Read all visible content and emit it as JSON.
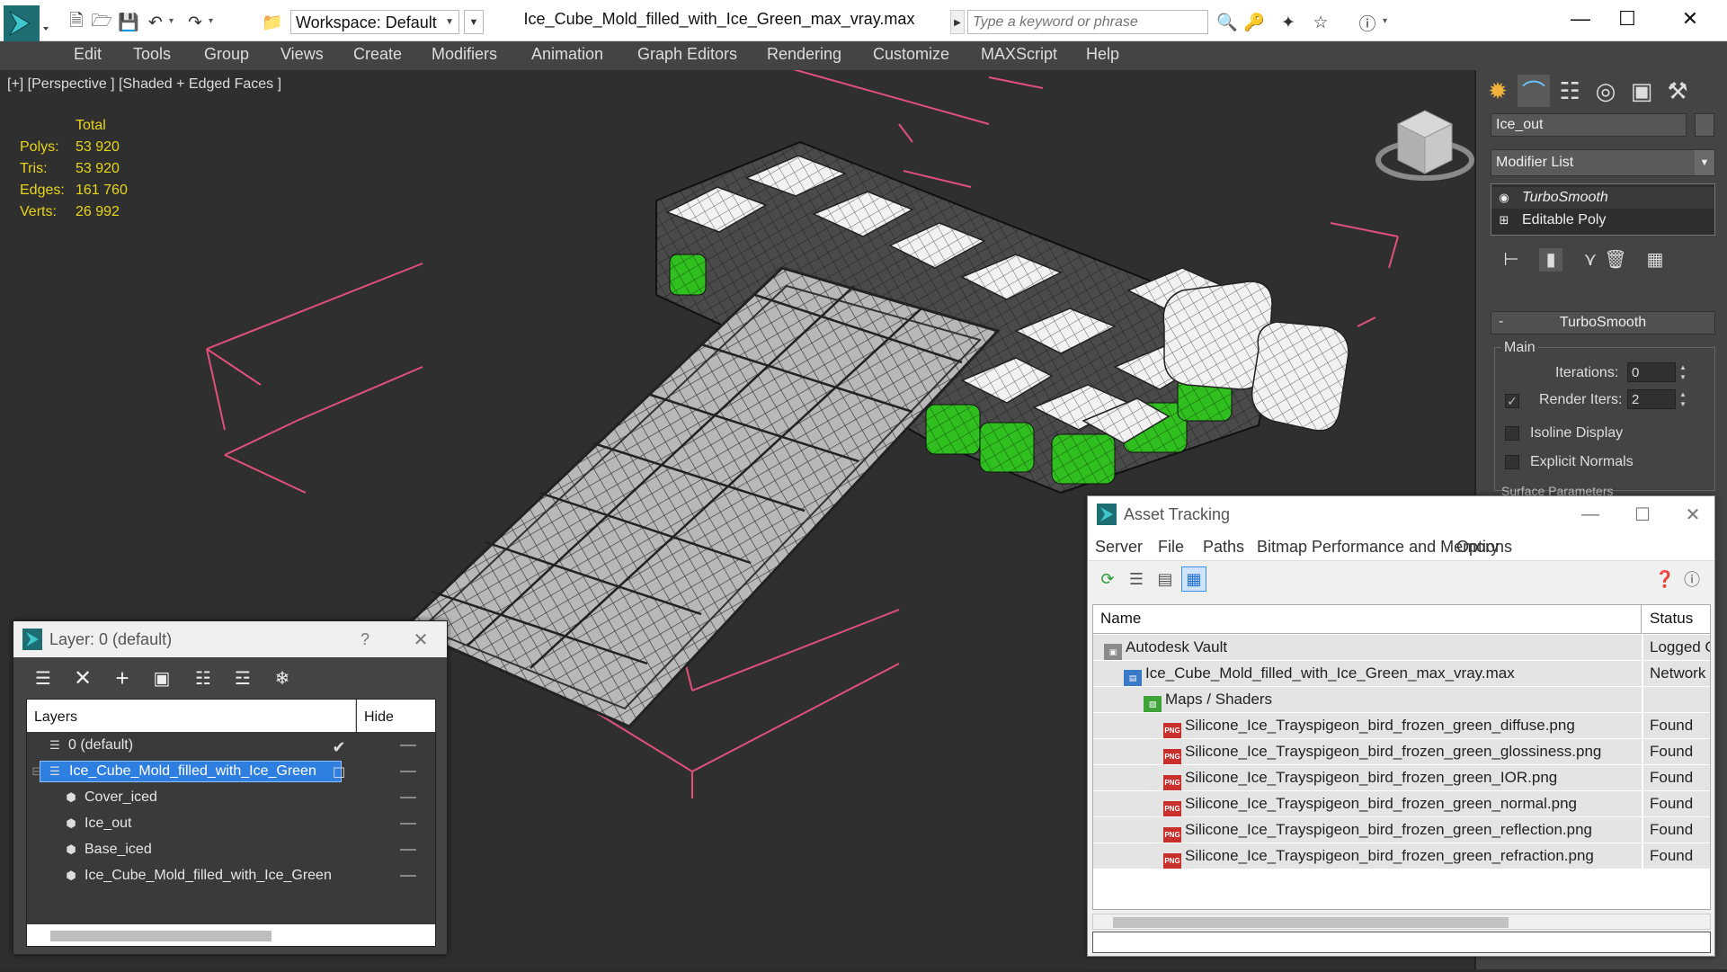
{
  "titlebar": {
    "workspace": "Workspace: Default",
    "document_title": "Ice_Cube_Mold_filled_with_Ice_Green_max_vray.max",
    "search_placeholder": "Type a keyword or phrase",
    "icons": [
      "new-file-icon",
      "open-folder-icon",
      "save-icon",
      "undo-icon",
      "redo-icon",
      "project-folder-icon",
      "binoculars-icon",
      "key-icon",
      "star-cross-icon",
      "favorite-star-icon",
      "help-icon"
    ]
  },
  "menu": [
    "Edit",
    "Tools",
    "Group",
    "Views",
    "Create",
    "Modifiers",
    "Animation",
    "Graph Editors",
    "Rendering",
    "Customize",
    "MAXScript",
    "Help"
  ],
  "viewport": {
    "label": "[+] [Perspective ] [Shaded + Edged Faces ]",
    "stats_header": "Total",
    "stats": [
      {
        "label": "Polys:",
        "value": "53 920"
      },
      {
        "label": "Tris:",
        "value": "53 920"
      },
      {
        "label": "Edges:",
        "value": "161 760"
      },
      {
        "label": "Verts:",
        "value": "26 992"
      }
    ]
  },
  "command_panel": {
    "object_name": "Ice_out",
    "modifier_list": "Modifier List",
    "stack": [
      "TurboSmooth",
      "Editable Poly"
    ],
    "rollout_title": "TurboSmooth",
    "group_main": "Main",
    "iterations_label": "Iterations:",
    "iterations_value": "0",
    "render_iters_label": "Render Iters:",
    "render_iters_value": "2",
    "isoline_label": "Isoline Display",
    "explicit_normals_label": "Explicit Normals",
    "surface_params_label": "Surface Parameters"
  },
  "asset_tracking": {
    "title": "Asset Tracking",
    "menu": [
      "Server",
      "File",
      "Paths",
      "Bitmap Performance and Memory",
      "Options"
    ],
    "columns": [
      "Name",
      "Status"
    ],
    "rows": [
      {
        "name": "Autodesk Vault",
        "status": "Logged O",
        "indent": 1,
        "icon": "vault"
      },
      {
        "name": "Ice_Cube_Mold_filled_with_Ice_Green_max_vray.max",
        "status": "Network",
        "indent": 2,
        "icon": "max"
      },
      {
        "name": "Maps / Shaders",
        "status": "",
        "indent": 3,
        "icon": "maps"
      },
      {
        "name": "Silicone_Ice_Trayspigeon_bird_frozen_green_diffuse.png",
        "status": "Found",
        "indent": 4,
        "icon": "png"
      },
      {
        "name": "Silicone_Ice_Trayspigeon_bird_frozen_green_glossiness.png",
        "status": "Found",
        "indent": 4,
        "icon": "png"
      },
      {
        "name": "Silicone_Ice_Trayspigeon_bird_frozen_green_IOR.png",
        "status": "Found",
        "indent": 4,
        "icon": "png"
      },
      {
        "name": "Silicone_Ice_Trayspigeon_bird_frozen_green_normal.png",
        "status": "Found",
        "indent": 4,
        "icon": "png"
      },
      {
        "name": "Silicone_Ice_Trayspigeon_bird_frozen_green_reflection.png",
        "status": "Found",
        "indent": 4,
        "icon": "png"
      },
      {
        "name": "Silicone_Ice_Trayspigeon_bird_frozen_green_refraction.png",
        "status": "Found",
        "indent": 4,
        "icon": "png"
      }
    ],
    "png_badge": "PNG"
  },
  "layer_dialog": {
    "title": "Layer: 0 (default)",
    "help": "?",
    "columns": [
      "Layers",
      "Hide"
    ],
    "rows": [
      {
        "name": "0 (default)",
        "type": "layer",
        "indent": 1,
        "checked": true,
        "selected": false
      },
      {
        "name": "Ice_Cube_Mold_filled_with_Ice_Green",
        "type": "layer",
        "indent": 1,
        "checked": false,
        "selected": true
      },
      {
        "name": "Cover_iced",
        "type": "object",
        "indent": 2,
        "checked": false,
        "selected": false
      },
      {
        "name": "Ice_out",
        "type": "object",
        "indent": 2,
        "checked": false,
        "selected": false
      },
      {
        "name": "Base_iced",
        "type": "object",
        "indent": 2,
        "checked": false,
        "selected": false
      },
      {
        "name": "Ice_Cube_Mold_filled_with_Ice_Green",
        "type": "object",
        "indent": 2,
        "checked": false,
        "selected": false
      }
    ]
  },
  "colors": {
    "accent_blue": "#1f6fd1",
    "selection": "#2f7fe0",
    "stats_yellow": "#e8d51a",
    "bbox_pink": "#e0507a",
    "ice_green": "#2fbf1f"
  }
}
